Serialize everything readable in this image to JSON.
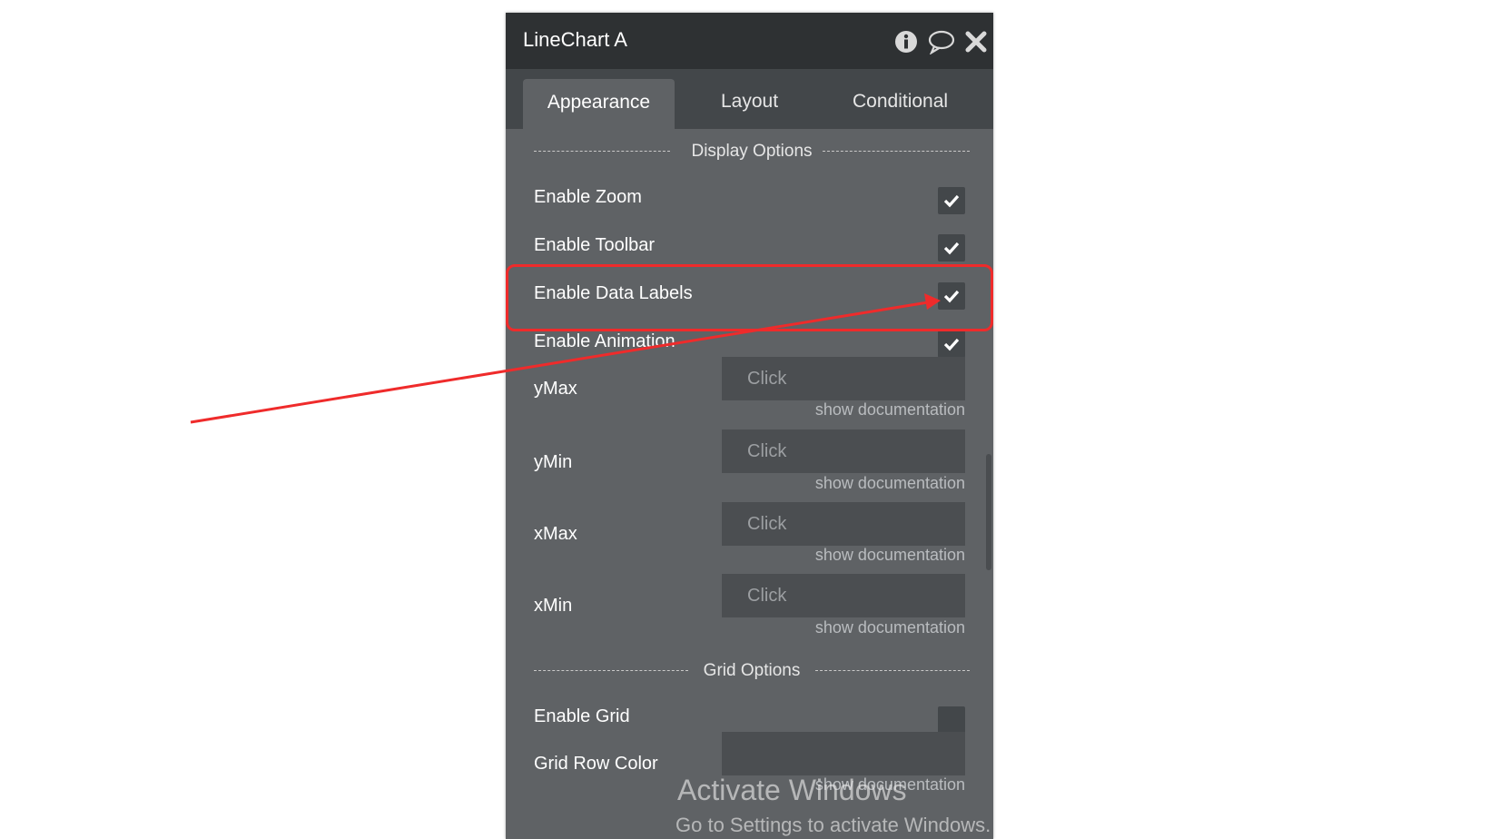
{
  "window": {
    "title": "LineChart A",
    "icons": [
      "info-icon",
      "comment-icon",
      "close-icon"
    ]
  },
  "tabs": [
    "Appearance",
    "Layout",
    "Conditional"
  ],
  "active_tab": "Appearance",
  "sections": {
    "display_options": "Display Options",
    "grid_options": "Grid Options"
  },
  "toggles": [
    {
      "label": "Enable Zoom",
      "checked": true
    },
    {
      "label": "Enable Toolbar",
      "checked": true
    },
    {
      "label": "Enable Data Labels",
      "checked": true
    },
    {
      "label": "Enable Animation",
      "checked": true
    },
    {
      "label": "Enable Grid",
      "checked": false
    }
  ],
  "fields": [
    {
      "label": "yMax",
      "placeholder": "Click",
      "doc_link": "show documentation"
    },
    {
      "label": "yMin",
      "placeholder": "Click",
      "doc_link": "show documentation"
    },
    {
      "label": "xMax",
      "placeholder": "Click",
      "doc_link": "show documentation"
    },
    {
      "label": "xMin",
      "placeholder": "Click",
      "doc_link": "show documentation"
    },
    {
      "label": "Grid Row Color",
      "placeholder": "",
      "doc_link": "show documentation"
    }
  ],
  "colors": {
    "annotation": "#ef2b2b",
    "panel_bg": "#5f6265",
    "titlebar_bg": "#2e3133",
    "tabbar_bg": "#43474a"
  },
  "watermark": {
    "title": "Activate Windows",
    "subtitle": "Go to Settings to activate Windows."
  }
}
